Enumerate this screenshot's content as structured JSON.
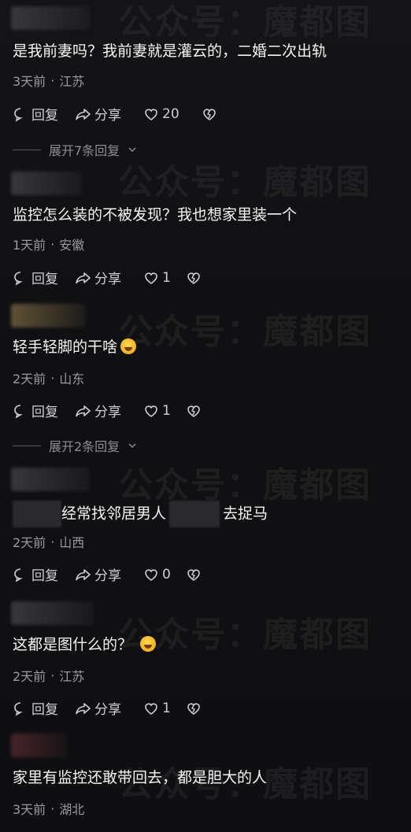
{
  "watermark": {
    "text": "公众号：魔都图"
  },
  "actions": {
    "reply": "回复",
    "share": "分享"
  },
  "comments": [
    {
      "text": "是我前妻吗？我前妻就是灌云的，二婚二次出轨",
      "time": "3天前",
      "location": "江苏",
      "likes": "20",
      "expand": "展开7条回复"
    },
    {
      "text": "监控怎么装的不被发现？我也想家里装一个",
      "time": "1天前",
      "location": "安徽",
      "likes": "1"
    },
    {
      "text": "轻手轻脚的干啥",
      "time": "2天前",
      "location": "山东",
      "likes": "1",
      "expand": "展开2条回复",
      "emoji": "laughing-emoji"
    },
    {
      "text_a": "经常找邻居男人",
      "text_b": "去捉马",
      "time": "2天前",
      "location": "山西",
      "likes": "0"
    },
    {
      "text": "这都是图什么的？",
      "time": "2天前",
      "location": "江苏",
      "likes": "1",
      "emoji": "laughing-emoji"
    },
    {
      "text": "家里有监控还敢带回去，都是胆大的人",
      "time": "3天前",
      "location": "湖北"
    }
  ],
  "separator": "·"
}
